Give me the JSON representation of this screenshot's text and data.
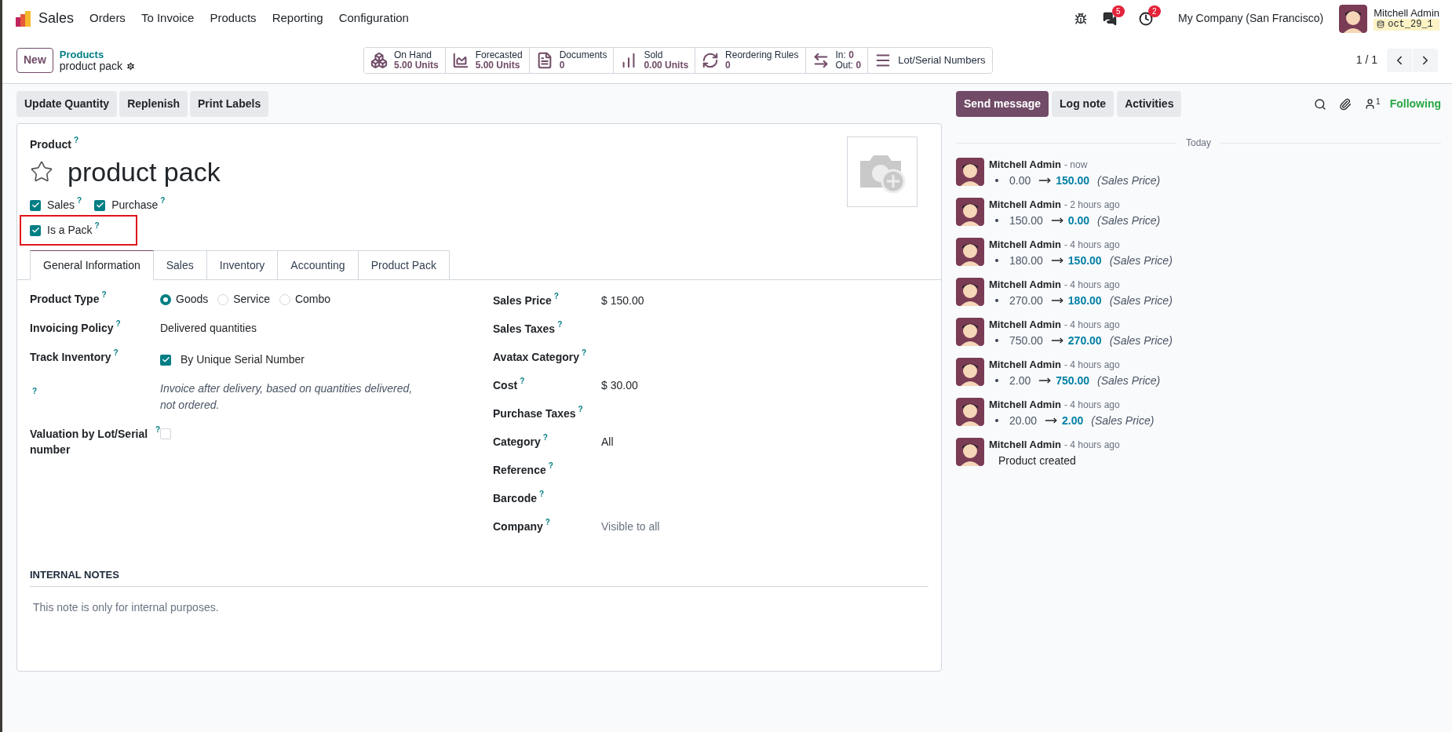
{
  "navbar": {
    "app": "Sales",
    "menu": [
      "Orders",
      "To Invoice",
      "Products",
      "Reporting",
      "Configuration"
    ],
    "messages_count": "5",
    "activities_count": "2",
    "company": "My Company (San Francisco)",
    "user": "Mitchell Admin",
    "database": "oct_29_1"
  },
  "control_panel": {
    "new_button": "New",
    "breadcrumb": "Products",
    "record": "product pack",
    "stat_buttons": [
      {
        "kind": "boxes",
        "label": "On Hand",
        "value": "5.00 Units"
      },
      {
        "kind": "area",
        "label": "Forecasted",
        "value": "5.00 Units"
      },
      {
        "kind": "document",
        "label": "Documents",
        "value": "0"
      },
      {
        "kind": "bars",
        "label": "Sold",
        "value": "0.00 Units"
      },
      {
        "kind": "refresh",
        "label": "Reordering Rules",
        "value": "0"
      },
      {
        "kind": "transfer",
        "lines": [
          {
            "label": "In:",
            "value": "0"
          },
          {
            "label": "Out:",
            "value": "0"
          }
        ]
      },
      {
        "kind": "list",
        "label": "Lot/Serial Numbers"
      }
    ],
    "pager": "1 / 1"
  },
  "action_buttons": [
    "Update Quantity",
    "Replenish",
    "Print Labels"
  ],
  "form": {
    "title_label": "Product",
    "help": "?",
    "name": "product pack",
    "favorite": false,
    "options": [
      [
        {
          "label": "Sales",
          "checked": true
        },
        {
          "label": "Purchase",
          "checked": true
        }
      ],
      [
        {
          "label": "Is a Pack",
          "checked": true,
          "highlighted": true
        }
      ]
    ],
    "tabs": [
      {
        "label": "General Information",
        "selected": true
      },
      {
        "label": "Sales",
        "selected": false
      },
      {
        "label": "Inventory",
        "selected": false
      },
      {
        "label": "Accounting",
        "selected": false
      },
      {
        "label": "Product Pack",
        "selected": false
      }
    ],
    "left_fields": [
      {
        "kind": "radio",
        "label": "Product Type",
        "choices": [
          {
            "label": "Goods",
            "selected": true
          },
          {
            "label": "Service",
            "selected": false
          },
          {
            "label": "Combo",
            "selected": false
          }
        ]
      },
      {
        "kind": "text",
        "label": "Invoicing Policy",
        "value": "Delivered quantities"
      },
      {
        "kind": "checkbox",
        "label": "Track Inventory",
        "checked": true,
        "value": "By Unique Serial Number"
      },
      {
        "kind": "note",
        "value": "Invoice after delivery, based on quantities delivered, not ordered."
      },
      {
        "kind": "checkbox",
        "label": "Valuation by Lot/Serial number",
        "checked": false
      }
    ],
    "right_fields": [
      {
        "label": "Sales Price",
        "value": "$ 150.00"
      },
      {
        "label": "Sales Taxes"
      },
      {
        "label": "Avatax Category"
      },
      {
        "label": "Cost",
        "value": "$ 30.00"
      },
      {
        "label": "Purchase Taxes"
      },
      {
        "label": "Category",
        "value": "All"
      },
      {
        "label": "Reference"
      },
      {
        "label": "Barcode"
      },
      {
        "label": "Company",
        "value": "Visible to all",
        "muted": true
      }
    ],
    "internal_notes": {
      "title": "INTERNAL NOTES",
      "placeholder": "This note is only for internal purposes."
    }
  },
  "chatter": {
    "buttons": [
      {
        "label": "Send message",
        "selected": true
      },
      {
        "label": "Log note",
        "selected": false
      },
      {
        "label": "Activities",
        "selected": false
      }
    ],
    "followers_count": "1",
    "following": "Following",
    "date_separator": "Today",
    "messages": [
      {
        "author": "Mitchell Admin",
        "time": "- now",
        "old": "0.00",
        "new": "150.00",
        "field": "(Sales Price)"
      },
      {
        "author": "Mitchell Admin",
        "time": "- 2 hours ago",
        "old": "150.00",
        "new": "0.00",
        "field": "(Sales Price)"
      },
      {
        "author": "Mitchell Admin",
        "time": "- 4 hours ago",
        "old": "180.00",
        "new": "150.00",
        "field": "(Sales Price)"
      },
      {
        "author": "Mitchell Admin",
        "time": "- 4 hours ago",
        "old": "270.00",
        "new": "180.00",
        "field": "(Sales Price)"
      },
      {
        "author": "Mitchell Admin",
        "time": "- 4 hours ago",
        "old": "750.00",
        "new": "270.00",
        "field": "(Sales Price)"
      },
      {
        "author": "Mitchell Admin",
        "time": "- 4 hours ago",
        "old": "2.00",
        "new": "750.00",
        "field": "(Sales Price)"
      },
      {
        "author": "Mitchell Admin",
        "time": "- 4 hours ago",
        "old": "20.00",
        "new": "2.00",
        "field": "(Sales Price)"
      },
      {
        "author": "Mitchell Admin",
        "time": "- 4 hours ago",
        "body": "Product created"
      }
    ]
  }
}
